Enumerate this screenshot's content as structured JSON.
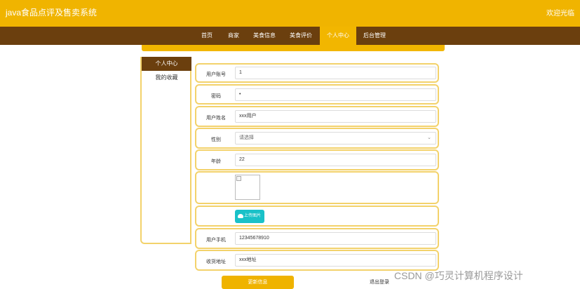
{
  "header": {
    "title": "java食品点评及售卖系统",
    "welcome": "欢迎光临"
  },
  "nav": {
    "items": [
      "首页",
      "商家",
      "美食信息",
      "美食评价",
      "个人中心",
      "后台管理"
    ],
    "active": "个人中心"
  },
  "sidebar": {
    "items": [
      "个人中心",
      "我的收藏"
    ]
  },
  "form": {
    "account_label": "用户账号",
    "account_value": "1",
    "password_label": "密码",
    "password_value": "•",
    "name_label": "用户姓名",
    "name_value": "xxx用户",
    "gender_label": "性别",
    "gender_placeholder": "请选择",
    "age_label": "年龄",
    "age_value": "22",
    "upload_label": "上传图片",
    "phone_label": "用户手机",
    "phone_value": "12345678910",
    "address_label": "收货地址",
    "address_value": "xxx地址",
    "update_button": "更新信息",
    "logout_link": "退出登录"
  },
  "watermark": "CSDN @巧灵计算机程序设计",
  "colors": {
    "accent": "#f0b400",
    "nav_bg": "#6b3f0e",
    "upload_button": "#19c1c8"
  }
}
